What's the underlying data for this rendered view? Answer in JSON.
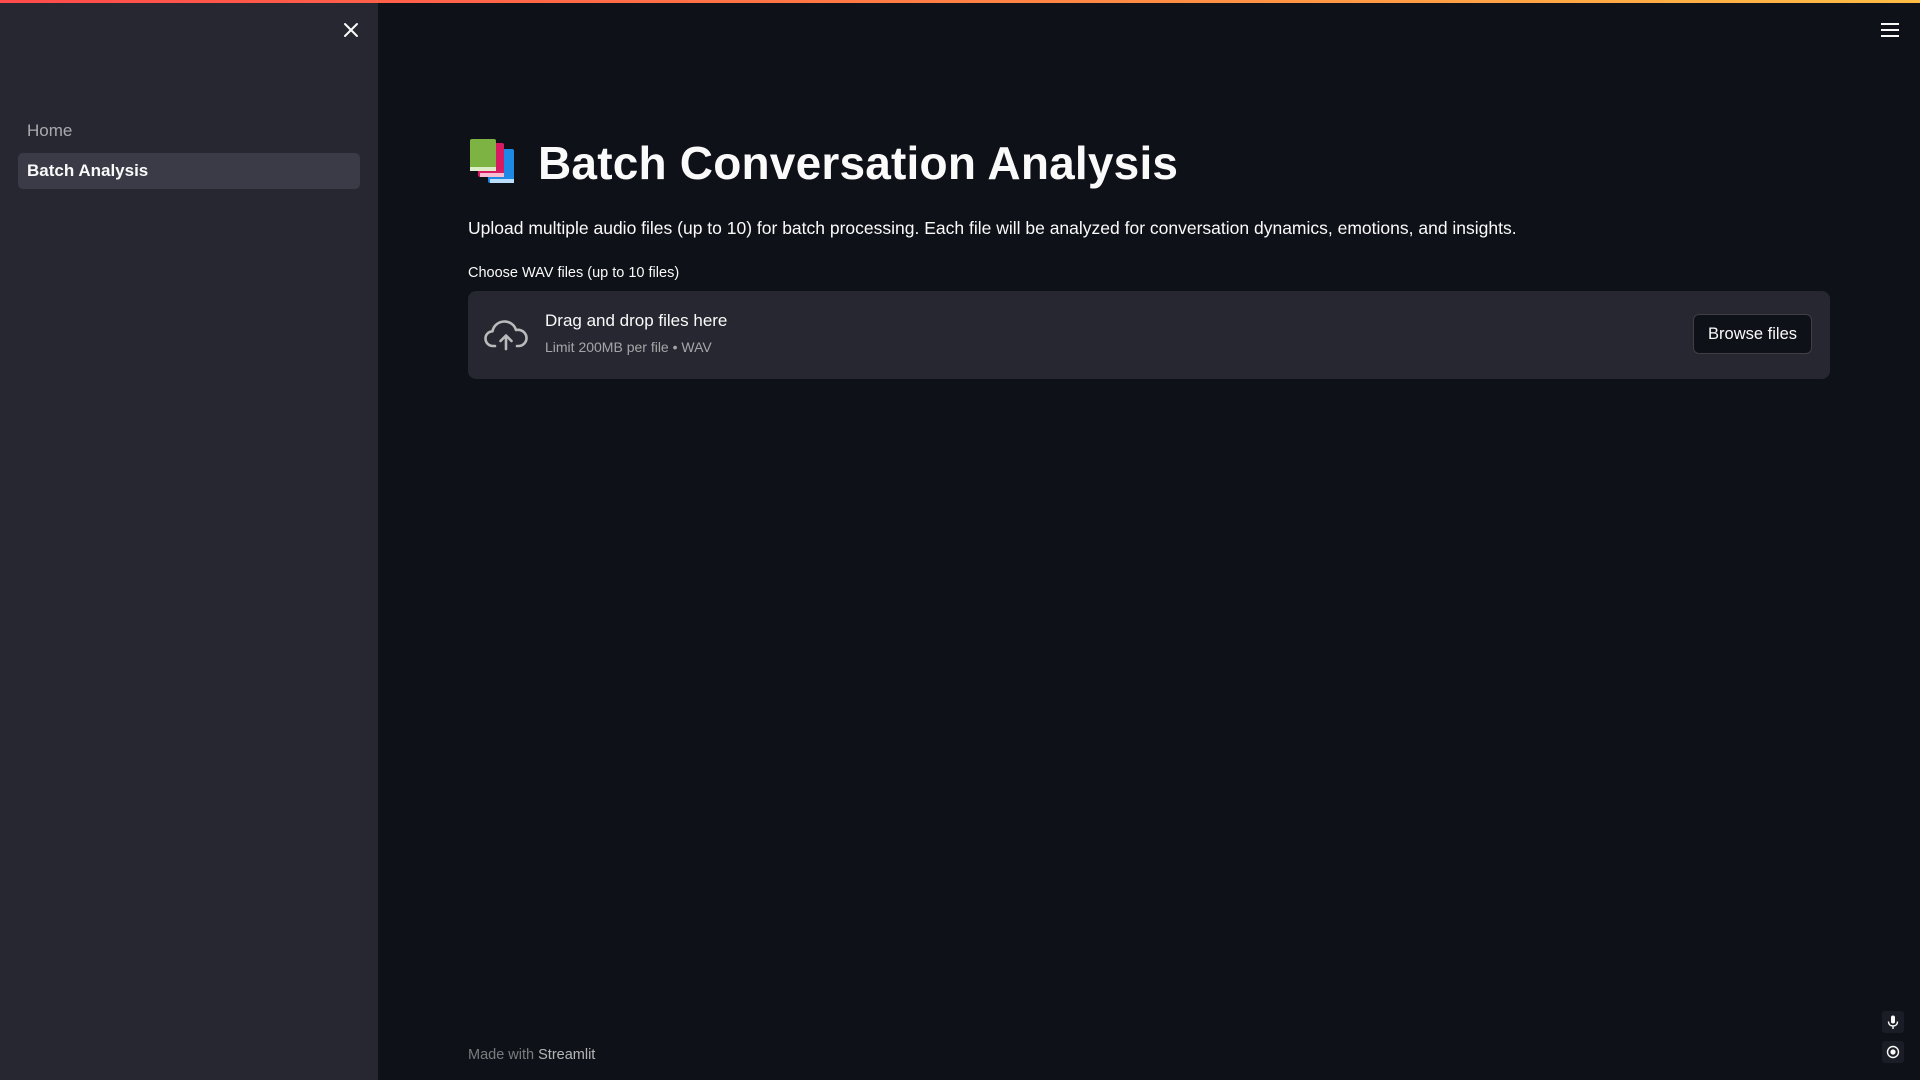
{
  "sidebar": {
    "items": [
      {
        "label": "Home",
        "active": false
      },
      {
        "label": "Batch Analysis",
        "active": true
      }
    ]
  },
  "main": {
    "title": "Batch Conversation Analysis",
    "title_icon": "books-emoji-icon",
    "description": "Upload multiple audio files (up to 10) for batch processing. Each file will be analyzed for conversation dynamics, emotions, and insights.",
    "uploader": {
      "label": "Choose WAV files (up to 10 files)",
      "drag_text": "Drag and drop files here",
      "limit_text": "Limit 200MB per file • WAV",
      "browse_label": "Browse files",
      "icon": "cloud-upload-icon"
    }
  },
  "footer": {
    "prefix": "Made with",
    "brand": "Streamlit"
  },
  "icons": {
    "close": "close-icon",
    "menu": "hamburger-menu-icon",
    "mic": "microphone-icon",
    "record": "record-icon"
  },
  "colors": {
    "background": "#0e1117",
    "sidebar": "#262730",
    "accent": "#ff4b4b"
  }
}
